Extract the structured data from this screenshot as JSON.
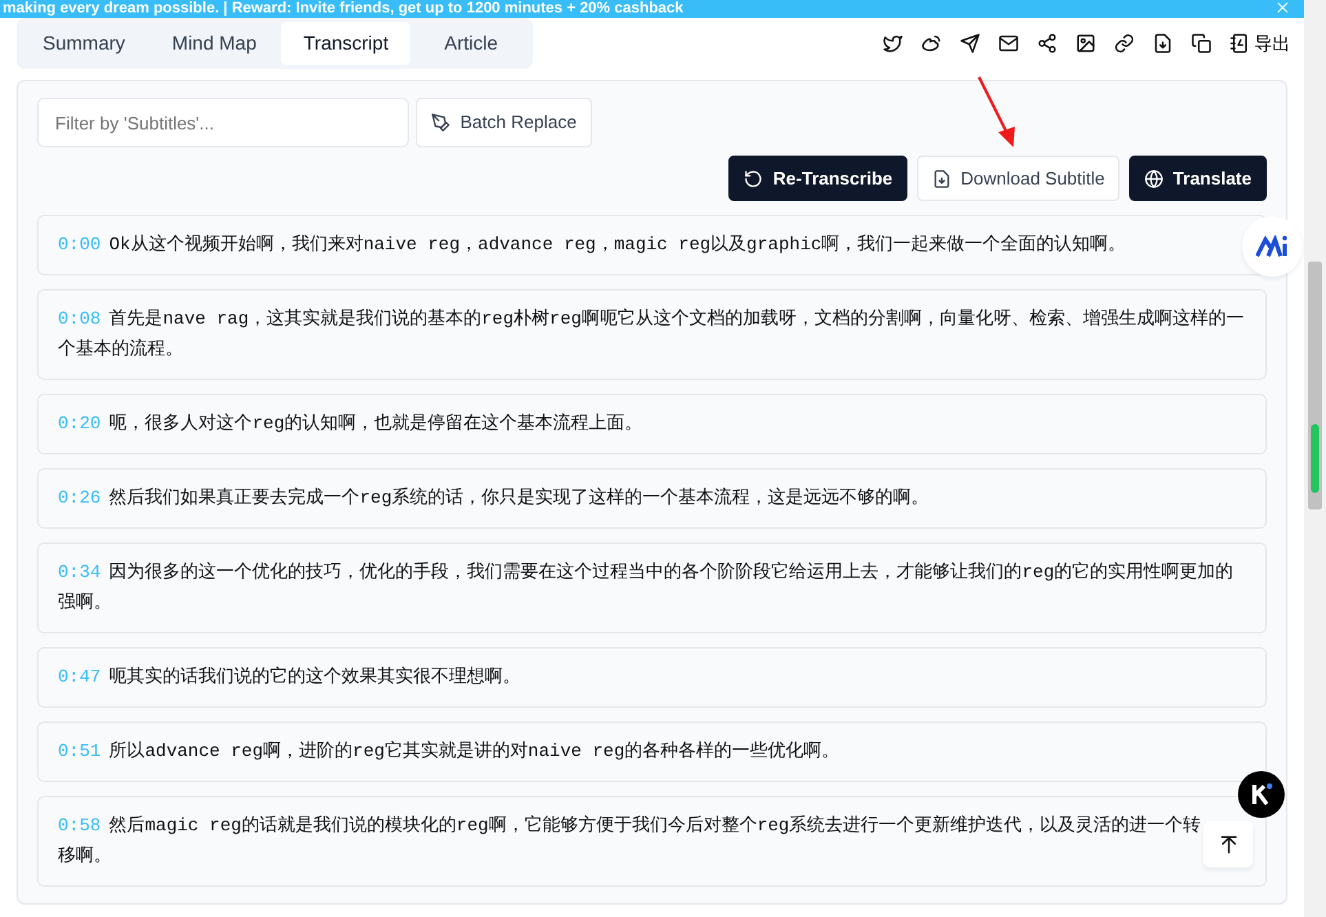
{
  "banner": {
    "text": "making every dream possible. | Reward: Invite friends, get up to 1200 minutes + 20% cashback"
  },
  "tabs": [
    {
      "label": "Summary",
      "selected": false
    },
    {
      "label": "Mind Map",
      "selected": false
    },
    {
      "label": "Transcript",
      "selected": true
    },
    {
      "label": "Article",
      "selected": false
    }
  ],
  "toolbar": {
    "export_label": "导出"
  },
  "filter": {
    "placeholder": "Filter by 'Subtitles'..."
  },
  "buttons": [
    {
      "label": "Batch Replace",
      "kind": "outline"
    },
    {
      "label": "Re-Transcribe",
      "kind": "dark"
    },
    {
      "label": "Download Subtitle",
      "kind": "outline"
    },
    {
      "label": "Translate",
      "kind": "dark"
    }
  ],
  "segments": [
    {
      "time": "0:00",
      "text": "Ok从这个视频开始啊，我们来对naive reg，advance reg，magic reg以及graphic啊，我们一起来做一个全面的认知啊。"
    },
    {
      "time": "0:08",
      "text": "首先是nave rag，这其实就是我们说的基本的reg朴树reg啊呃它从这个文档的加载呀，文档的分割啊，向量化呀、检索、增强生成啊这样的一个基本的流程。"
    },
    {
      "time": "0:20",
      "text": "呃，很多人对这个reg的认知啊，也就是停留在这个基本流程上面。"
    },
    {
      "time": "0:26",
      "text": "然后我们如果真正要去完成一个reg系统的话，你只是实现了这样的一个基本流程，这是远远不够的啊。"
    },
    {
      "time": "0:34",
      "text": "因为很多的这一个优化的技巧，优化的手段，我们需要在这个过程当中的各个阶阶段它给运用上去，才能够让我们的reg的它的实用性啊更加的强啊。"
    },
    {
      "time": "0:47",
      "text": "呃其实的话我们说的它的这个效果其实很不理想啊。"
    },
    {
      "time": "0:51",
      "text": "所以advance reg啊，进阶的reg它其实就是讲的对naive reg的各种各样的一些优化啊。"
    },
    {
      "time": "0:58",
      "text": "然后magic reg的话就是我们说的模块化的reg啊，它能够方便于我们今后对整个reg系统去进行一个更新维护迭代，以及灵活的进一个转移啊。"
    }
  ]
}
